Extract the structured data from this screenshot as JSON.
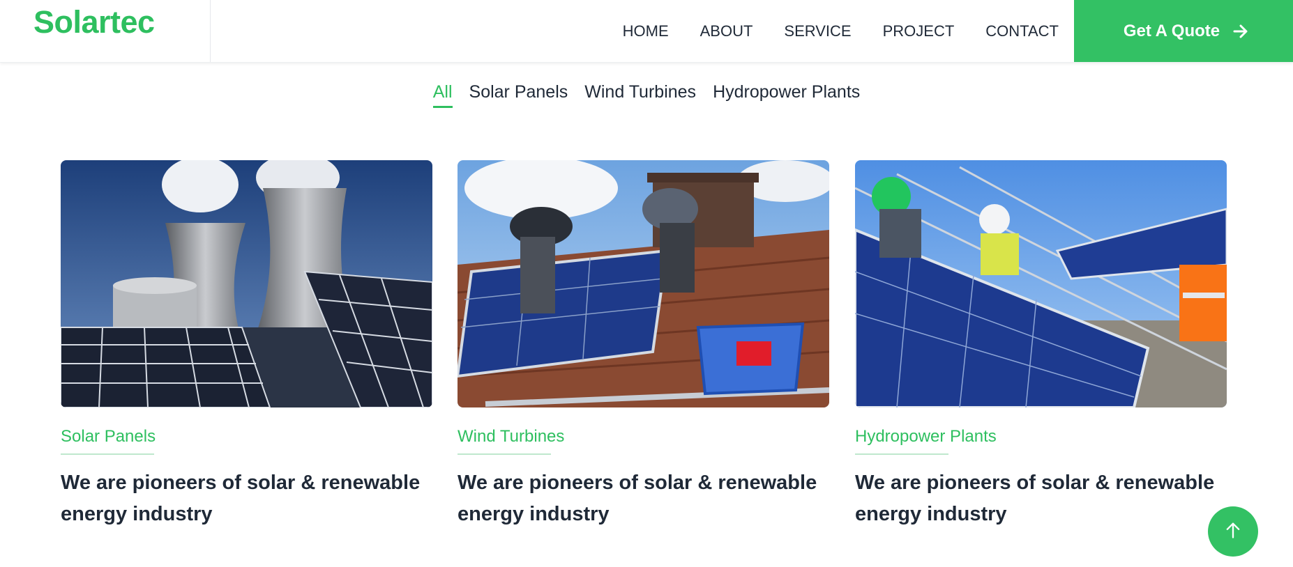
{
  "header": {
    "logo": "Solartec",
    "nav": [
      "HOME",
      "ABOUT",
      "SERVICE",
      "PROJECT",
      "CONTACT"
    ],
    "cta_label": "Get A Quote",
    "cta_icon": "arrow-right-icon"
  },
  "filters": [
    "All",
    "Solar Panels",
    "Wind Turbines",
    "Hydropower Plants"
  ],
  "active_filter": "All",
  "projects": [
    {
      "category": "Solar Panels",
      "title": "We are pioneers of solar & renewable energy industry",
      "image": "cooling-towers-and-solar-panels"
    },
    {
      "category": "Wind Turbines",
      "title": "We are pioneers of solar & renewable energy industry",
      "image": "workers-installing-panels-on-roof"
    },
    {
      "category": "Hydropower Plants",
      "title": "We are pioneers of solar & renewable energy industry",
      "image": "workers-in-helmets-with-panels"
    }
  ],
  "back_to_top_icon": "arrow-up-icon",
  "colors": {
    "accent": "#33c164",
    "text": "#1f2937"
  }
}
